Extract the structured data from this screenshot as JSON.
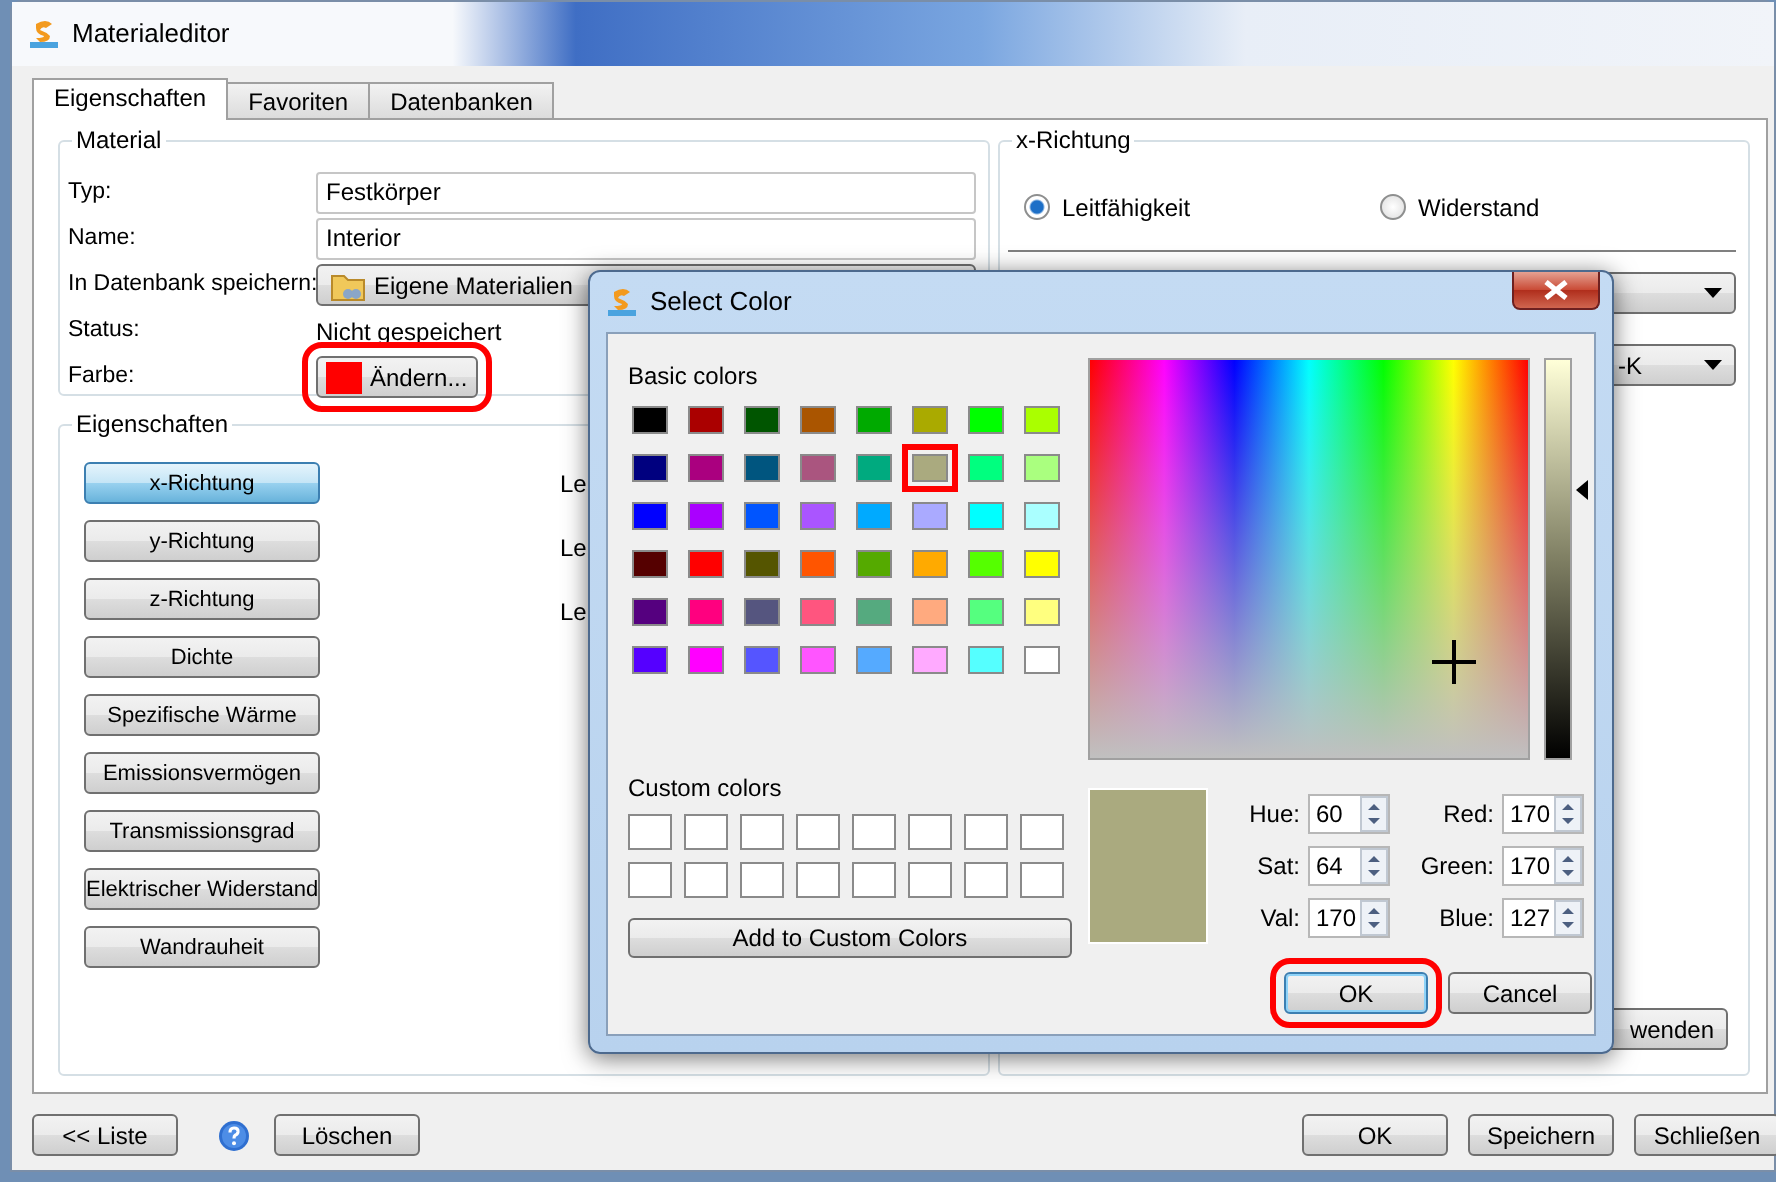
{
  "window": {
    "title": "Materialeditor"
  },
  "tabs": [
    {
      "label": "Eigenschaften",
      "selected": true
    },
    {
      "label": "Favoriten",
      "selected": false
    },
    {
      "label": "Datenbanken",
      "selected": false
    }
  ],
  "material": {
    "legend": "Material",
    "fields": [
      {
        "label": "Typ:",
        "kind": "input",
        "value": "Festkörper"
      },
      {
        "label": "Name:",
        "kind": "input",
        "value": "Interior"
      },
      {
        "label": "In Datenbank speichern:",
        "kind": "dropdown",
        "value": "Eigene Materialien"
      },
      {
        "label": "Status:",
        "kind": "text",
        "value": "Nicht gespeichert"
      },
      {
        "label": "Farbe:",
        "kind": "color",
        "value": "Ändern...",
        "color": "#ff0000",
        "highlighted": true
      }
    ]
  },
  "properties": {
    "legend": "Eigenschaften",
    "buttons": [
      {
        "label": "x-Richtung",
        "selected": true
      },
      {
        "label": "y-Richtung",
        "selected": false
      },
      {
        "label": "z-Richtung",
        "selected": false
      },
      {
        "label": "Dichte",
        "selected": false
      },
      {
        "label": "Spezifische Wärme",
        "selected": false
      },
      {
        "label": "Emissionsvermögen",
        "selected": false
      },
      {
        "label": "Transmissionsgrad",
        "selected": false
      },
      {
        "label": "Elektrischer Widerstand",
        "selected": false
      },
      {
        "label": "Wandrauheit",
        "selected": false
      }
    ],
    "side_labels": [
      "Le",
      "Le",
      "Le"
    ]
  },
  "x_direction": {
    "legend": "x-Richtung",
    "options": [
      {
        "label": "Leitfähigkeit",
        "selected": true
      },
      {
        "label": "Widerstand",
        "selected": false
      }
    ],
    "unit_dropdown": {
      "value": "-K"
    },
    "apply_button": {
      "label": "wenden"
    }
  },
  "footer": {
    "list_button": "<< Liste",
    "delete_button": "Löschen",
    "right_buttons": [
      "OK",
      "Speichern",
      "Schließen"
    ]
  },
  "dialog": {
    "title": "Select Color",
    "basic_colors_label": "Basic colors",
    "basic_colors": [
      {
        "color": "#000000",
        "selected": false
      },
      {
        "color": "#aa0000",
        "selected": false
      },
      {
        "color": "#005500",
        "selected": false
      },
      {
        "color": "#aa5500",
        "selected": false
      },
      {
        "color": "#00aa00",
        "selected": false
      },
      {
        "color": "#aaaa00",
        "selected": false
      },
      {
        "color": "#00ff00",
        "selected": false
      },
      {
        "color": "#aaff00",
        "selected": false
      },
      {
        "color": "#00007f",
        "selected": false
      },
      {
        "color": "#aa007f",
        "selected": false
      },
      {
        "color": "#00557f",
        "selected": false
      },
      {
        "color": "#aa557f",
        "selected": false
      },
      {
        "color": "#00aa7f",
        "selected": false
      },
      {
        "color": "#aaaa7f",
        "selected": true
      },
      {
        "color": "#00ff7f",
        "selected": false
      },
      {
        "color": "#aaff7f",
        "selected": false
      },
      {
        "color": "#0000ff",
        "selected": false
      },
      {
        "color": "#aa00ff",
        "selected": false
      },
      {
        "color": "#0055ff",
        "selected": false
      },
      {
        "color": "#aa55ff",
        "selected": false
      },
      {
        "color": "#00aaff",
        "selected": false
      },
      {
        "color": "#aaaaff",
        "selected": false
      },
      {
        "color": "#00ffff",
        "selected": false
      },
      {
        "color": "#aaffff",
        "selected": false
      },
      {
        "color": "#550000",
        "selected": false
      },
      {
        "color": "#ff0000",
        "selected": false
      },
      {
        "color": "#555500",
        "selected": false
      },
      {
        "color": "#ff5500",
        "selected": false
      },
      {
        "color": "#55aa00",
        "selected": false
      },
      {
        "color": "#ffaa00",
        "selected": false
      },
      {
        "color": "#55ff00",
        "selected": false
      },
      {
        "color": "#ffff00",
        "selected": false
      },
      {
        "color": "#55007f",
        "selected": false
      },
      {
        "color": "#ff007f",
        "selected": false
      },
      {
        "color": "#55557f",
        "selected": false
      },
      {
        "color": "#ff557f",
        "selected": false
      },
      {
        "color": "#55aa7f",
        "selected": false
      },
      {
        "color": "#ffaa7f",
        "selected": false
      },
      {
        "color": "#55ff7f",
        "selected": false
      },
      {
        "color": "#ffff7f",
        "selected": false
      },
      {
        "color": "#5500ff",
        "selected": false
      },
      {
        "color": "#ff00ff",
        "selected": false
      },
      {
        "color": "#5555ff",
        "selected": false
      },
      {
        "color": "#ff55ff",
        "selected": false
      },
      {
        "color": "#55aaff",
        "selected": false
      },
      {
        "color": "#ffaaff",
        "selected": false
      },
      {
        "color": "#55ffff",
        "selected": false
      },
      {
        "color": "#ffffff",
        "selected": false
      }
    ],
    "custom_colors_label": "Custom colors",
    "custom_colors": [
      {
        "color": "#ffffff"
      },
      {
        "color": "#ffffff"
      },
      {
        "color": "#ffffff"
      },
      {
        "color": "#ffffff"
      },
      {
        "color": "#ffffff"
      },
      {
        "color": "#ffffff"
      },
      {
        "color": "#ffffff"
      },
      {
        "color": "#ffffff"
      },
      {
        "color": "#ffffff"
      },
      {
        "color": "#ffffff"
      },
      {
        "color": "#ffffff"
      },
      {
        "color": "#ffffff"
      },
      {
        "color": "#ffffff"
      },
      {
        "color": "#ffffff"
      },
      {
        "color": "#ffffff"
      },
      {
        "color": "#ffffff"
      }
    ],
    "add_button": "Add to Custom Colors",
    "value_slider": {
      "level": 0.67
    },
    "spin_fields": [
      {
        "label": "Hue:",
        "value": "60"
      },
      {
        "label": "Red:",
        "value": "170"
      },
      {
        "label": "Sat:",
        "value": "64"
      },
      {
        "label": "Green:",
        "value": "170"
      },
      {
        "label": "Val:",
        "value": "170"
      },
      {
        "label": "Blue:",
        "value": "127"
      }
    ],
    "buttons": [
      {
        "label": "OK",
        "highlighted": true
      },
      {
        "label": "Cancel",
        "highlighted": false
      }
    ]
  }
}
